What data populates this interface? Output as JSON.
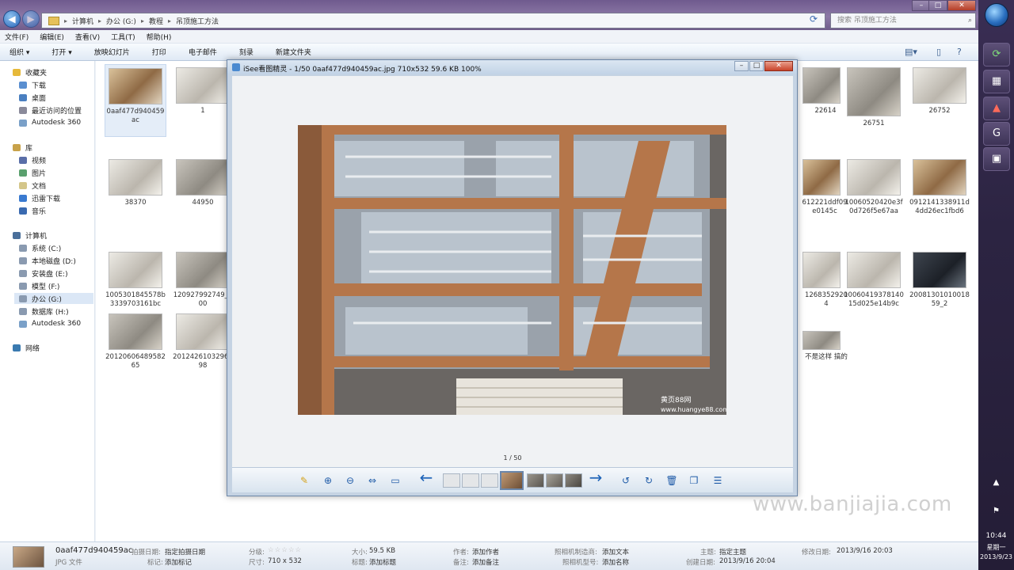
{
  "explorer": {
    "breadcrumbs": [
      "计算机",
      "办公 (G:)",
      "教程",
      "吊顶施工方法"
    ],
    "search_placeholder": "搜索 吊顶施工方法",
    "window_buttons": [
      "–",
      "□",
      "✕"
    ]
  },
  "menu": [
    "文件(F)",
    "编辑(E)",
    "查看(V)",
    "工具(T)",
    "帮助(H)"
  ],
  "commands": [
    "组织 ▾",
    "打开 ▾",
    "放映幻灯片",
    "打印",
    "电子邮件",
    "刻录",
    "新建文件夹"
  ],
  "nav": {
    "favorites_header": "收藏夹",
    "favorites": [
      "下载",
      "桌面",
      "最近访问的位置",
      "Autodesk 360"
    ],
    "libraries_header": "库",
    "libraries": [
      "视频",
      "图片",
      "文档",
      "迅雷下载",
      "音乐"
    ],
    "computer_header": "计算机",
    "drives": [
      "系统 (C:)",
      "本地磁盘 (D:)",
      "安装盘 (E:)",
      "模型 (F:)",
      "办公 (G:)",
      "数据库 (H:)",
      "Autodesk 360"
    ],
    "network": "网络"
  },
  "files": [
    {
      "label": "0aaf477d940459ac",
      "tone": "warm"
    },
    {
      "label": "1",
      "tone": "light"
    },
    {
      "label": "38370",
      "tone": "light"
    },
    {
      "label": "44950",
      "tone": "gray"
    },
    {
      "label": "1005301845578b3339703161bc",
      "tone": "light"
    },
    {
      "label": "120927992749_000",
      "tone": "gray"
    },
    {
      "label": "2012060648958265",
      "tone": "gray"
    },
    {
      "label": "20124261032961 98",
      "tone": "light"
    },
    {
      "label": "22614",
      "tone": "gray"
    },
    {
      "label": "26751",
      "tone": "gray"
    },
    {
      "label": "26752",
      "tone": "light"
    },
    {
      "label": "612221ddf09e0145c",
      "tone": "warm"
    },
    {
      "label": "10060520420e3f0d726f5e67aa",
      "tone": "light"
    },
    {
      "label": "0912141338911d4dd26ec1fbd6",
      "tone": "warm"
    },
    {
      "label": "12683529204",
      "tone": "light"
    },
    {
      "label": "10060419378140 15d025e14b9c",
      "tone": "light"
    },
    {
      "label": "2008130101001859_2",
      "tone": "dark"
    },
    {
      "label": "不是这样 搞的",
      "tone": "gray"
    }
  ],
  "viewer": {
    "title": "iSee看图精灵 - 1/50  0aaf477d940459ac.jpg  710x532  59.6 KB  100%",
    "counter": "1 / 50",
    "photo_watermark_cn": "黄页88网",
    "photo_watermark_url": "www.huangye88.com",
    "toolbar_icons": [
      "brush-icon",
      "zoom-in-icon",
      "zoom-out-icon",
      "fit-icon",
      "slideshow-icon",
      "prev-arrow-icon",
      "next-arrow-icon",
      "rotate-left-icon",
      "rotate-right-icon",
      "delete-icon",
      "copy-icon",
      "menu-icon"
    ]
  },
  "watermark": "www.banjiajia.com",
  "details": {
    "filename": "0aaf477d940459ac",
    "filetype": "JPG 文件",
    "shot_date_k": "拍摄日期:",
    "shot_date_v": "指定拍摄日期",
    "tags_k": "标记:",
    "tags_v": "添加标记",
    "rating_k": "分级:",
    "rating_v": "☆☆☆☆☆",
    "dims_k": "尺寸:",
    "dims_v": "710 x 532",
    "size_k": "大小:",
    "size_v": "59.5 KB",
    "title_k": "标题:",
    "title_v": "添加标题",
    "author_k": "作者:",
    "author_v": "添加作者",
    "comment_k": "备注:",
    "comment_v": "添加备注",
    "cam_maker_k": "照相机制造商:",
    "cam_maker_v": "添加文本",
    "cam_model_k": "照相机型号:",
    "cam_model_v": "添加名称",
    "subject_k": "主题:",
    "subject_v": "指定主题",
    "created_k": "创建日期:",
    "created_v": "2013/9/16 20:04",
    "modified_k": "修改日期:",
    "modified_v": "2013/9/16 20:03"
  },
  "clock": {
    "time": "10:44",
    "day": "星期一",
    "date": "2013/9/23"
  },
  "colors": {
    "accent": "#1e63b8",
    "titlebar": "#7a6698",
    "taskbar": "#2c2442"
  }
}
